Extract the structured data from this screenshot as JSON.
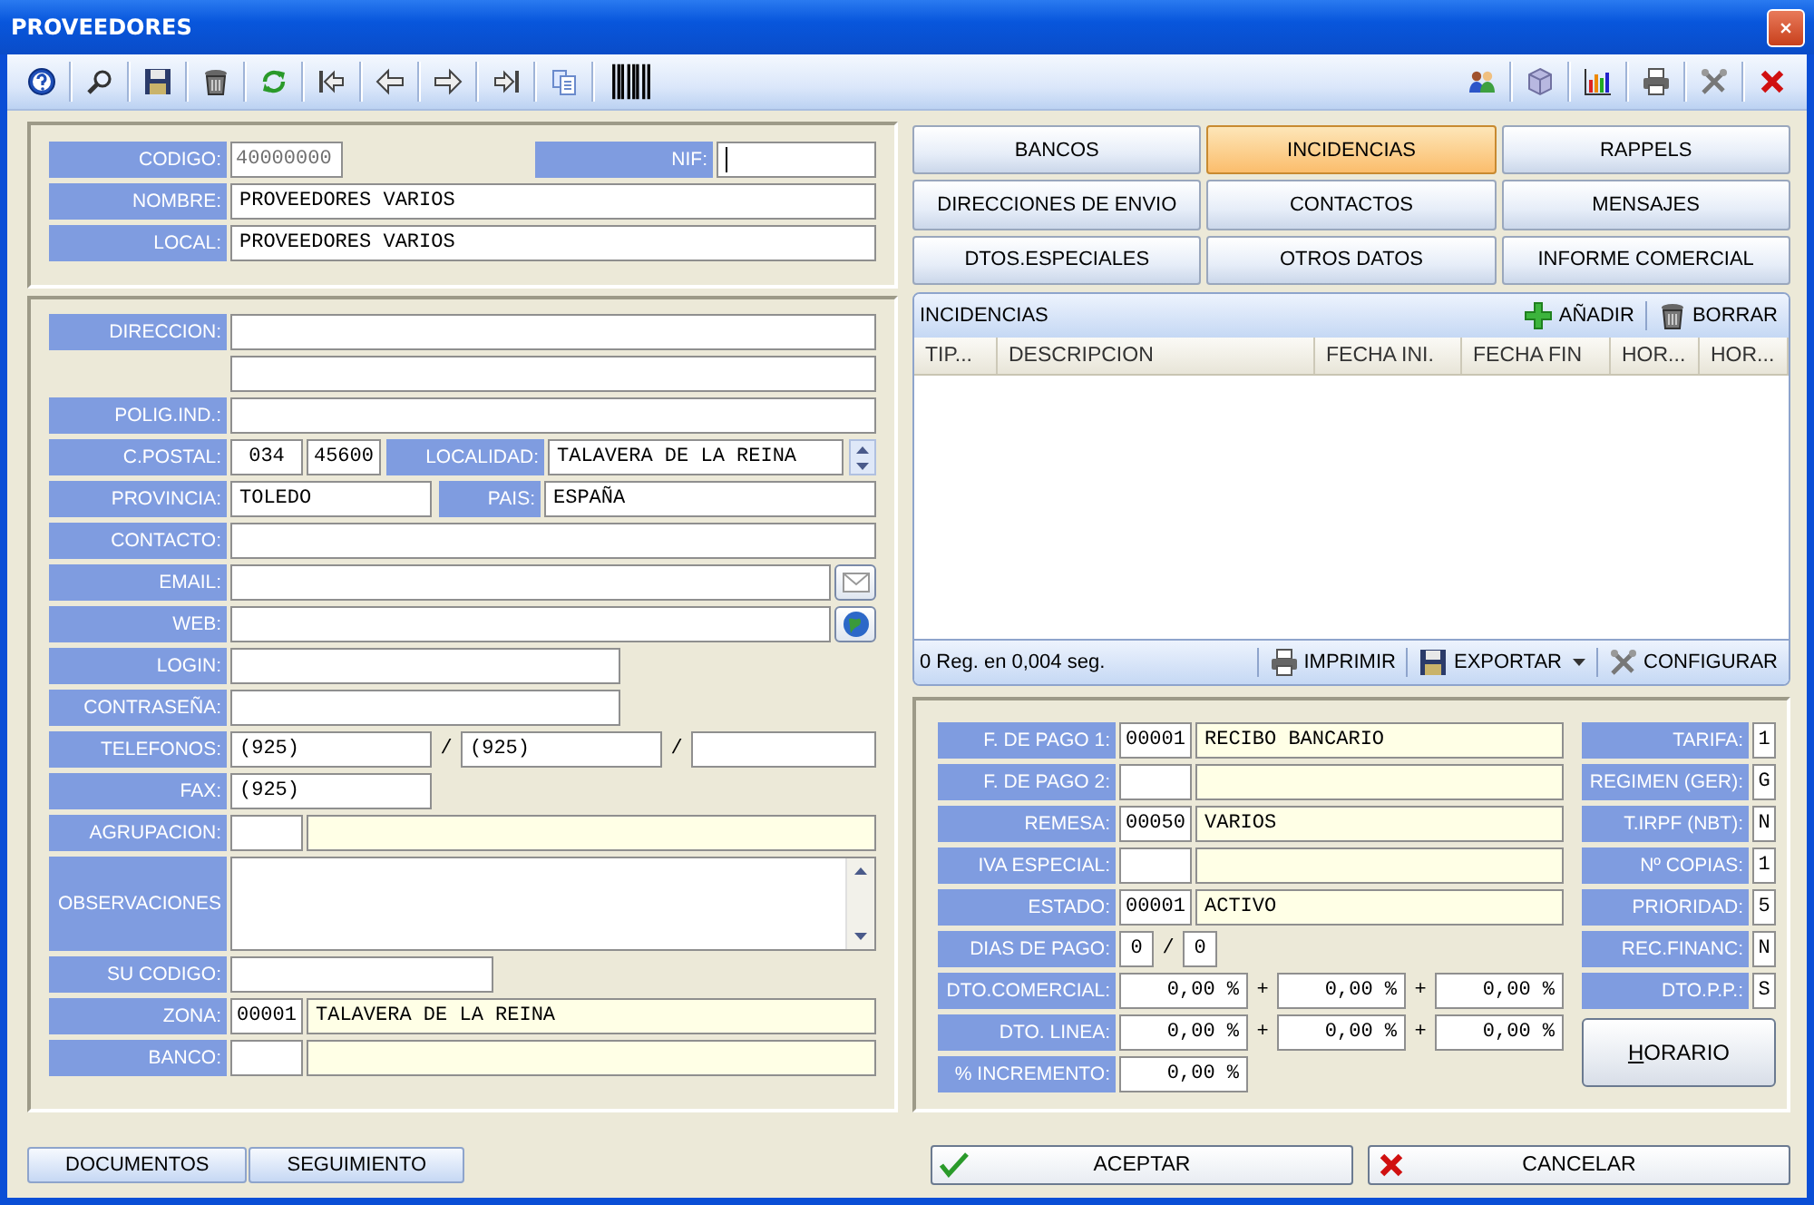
{
  "window": {
    "title": "PROVEEDORES"
  },
  "header_form": {
    "rows": [
      [
        {
          "kind": "label",
          "text": "CODIGO:"
        },
        {
          "kind": "code8",
          "value": "40000000",
          "disabled": true,
          "focused": false
        },
        {
          "kind": "spacer"
        },
        {
          "kind": "label",
          "text": "NIF:"
        },
        {
          "kind": "nif",
          "disabled": false,
          "focused": true
        }
      ],
      [
        {
          "kind": "label",
          "text": "NOMBRE:"
        },
        {
          "kind": "input",
          "value": "PROVEEDORES VARIOS"
        }
      ],
      [
        {
          "kind": "label",
          "text": "LOCAL:"
        },
        {
          "kind": "input",
          "value": "PROVEEDORES VARIOS"
        }
      ]
    ]
  },
  "address_form": {
    "rows": [
      [
        {
          "kind": "label",
          "text": "DIRECCION:"
        },
        {
          "kind": "input"
        }
      ],
      [
        {
          "kind": "gap"
        },
        {
          "kind": "input"
        }
      ],
      [
        {
          "kind": "label",
          "text": "POLIG.IND.:"
        },
        {
          "kind": "input"
        }
      ],
      [
        {
          "kind": "label",
          "text": "C.POSTAL:"
        },
        {
          "kind": "code",
          "value": "034"
        },
        {
          "kind": "zip",
          "value": "45600"
        },
        {
          "kind": "label-m",
          "text": "LOCALIDAD:"
        },
        {
          "kind": "input",
          "value": "TALAVERA DE LA REINA"
        },
        {
          "kind": "spin"
        }
      ],
      [
        {
          "kind": "label",
          "text": "PROVINCIA:"
        },
        {
          "kind": "md",
          "value": "TOLEDO"
        },
        {
          "kind": "label-s",
          "text": "PAIS:"
        },
        {
          "kind": "input",
          "value": "ESPAÑA"
        }
      ],
      [
        {
          "kind": "label",
          "text": "CONTACTO:"
        },
        {
          "kind": "input"
        }
      ],
      [
        {
          "kind": "label",
          "text": "EMAIL:"
        },
        {
          "kind": "input"
        },
        {
          "kind": "mail"
        }
      ],
      [
        {
          "kind": "label",
          "text": "WEB:"
        },
        {
          "kind": "input"
        },
        {
          "kind": "globe"
        }
      ],
      [
        {
          "kind": "label",
          "text": "LOGIN:"
        },
        {
          "kind": "lg"
        }
      ],
      [
        {
          "kind": "label",
          "text": "CONTRASEÑA:"
        },
        {
          "kind": "lg"
        }
      ],
      [
        {
          "kind": "label",
          "text": "TELEFONOS:"
        },
        {
          "kind": "md",
          "value": "(925)"
        },
        {
          "kind": "sep",
          "text": "/"
        },
        {
          "kind": "md",
          "value": "(925)"
        },
        {
          "kind": "sep",
          "text": "/"
        },
        {
          "kind": "input"
        }
      ],
      [
        {
          "kind": "label",
          "text": "FAX:"
        },
        {
          "kind": "md",
          "value": "(925)"
        }
      ],
      [
        {
          "kind": "label",
          "text": "AGRUPACION:"
        },
        {
          "kind": "code"
        },
        {
          "kind": "lookup"
        }
      ],
      [
        {
          "kind": "label",
          "text": "OBSERVACIONES"
        },
        {
          "kind": "memo"
        }
      ],
      [
        {
          "kind": "label",
          "text": "SU CODIGO:"
        },
        {
          "kind": "xl"
        }
      ],
      [
        {
          "kind": "label",
          "text": "ZONA:"
        },
        {
          "kind": "code",
          "value": "00001"
        },
        {
          "kind": "lookup",
          "value": "TALAVERA DE LA REINA"
        }
      ],
      [
        {
          "kind": "label",
          "text": "BANCO:"
        },
        {
          "kind": "code"
        },
        {
          "kind": "lookup"
        }
      ]
    ]
  },
  "tabs": [
    {
      "label": "BANCOS",
      "selected": false
    },
    {
      "label": "INCIDENCIAS",
      "selected": true
    },
    {
      "label": "RAPPELS",
      "selected": false
    },
    {
      "label": "DIRECCIONES DE ENVIO",
      "selected": false
    },
    {
      "label": "CONTACTOS",
      "selected": false
    },
    {
      "label": "MENSAJES",
      "selected": false
    },
    {
      "label": "DTOS.ESPECIALES",
      "selected": false
    },
    {
      "label": "OTROS DATOS",
      "selected": false
    },
    {
      "label": "INFORME COMERCIAL",
      "selected": false
    }
  ],
  "incidencias": {
    "title": "INCIDENCIAS",
    "actions": [
      "AÑADIR",
      "BORRAR"
    ],
    "columns": [
      "TIP...",
      "DESCRIPCION",
      "FECHA INI.",
      "FECHA FIN",
      "HOR...",
      "HOR..."
    ],
    "status": "0 Reg. en 0,004 seg.",
    "footer_actions": [
      {
        "label": "IMPRIMIR",
        "dropdown": false
      },
      {
        "label": "EXPORTAR",
        "dropdown": true
      },
      {
        "label": "CONFIGURAR",
        "dropdown": false
      }
    ]
  },
  "payment_form": {
    "rows": [
      [
        {
          "kind": "label",
          "text": "F. DE PAGO 1:"
        },
        {
          "kind": "code",
          "value": "00001"
        },
        {
          "kind": "lookup",
          "value": "RECIBO BANCARIO"
        }
      ],
      [
        {
          "kind": "label",
          "text": "F. DE PAGO 2:"
        },
        {
          "kind": "code"
        },
        {
          "kind": "lookup"
        }
      ],
      [
        {
          "kind": "label",
          "text": "REMESA:"
        },
        {
          "kind": "code",
          "value": "00050"
        },
        {
          "kind": "lookup",
          "value": "VARIOS"
        }
      ],
      [
        {
          "kind": "label",
          "text": "IVA ESPECIAL:"
        },
        {
          "kind": "code"
        },
        {
          "kind": "lookup"
        }
      ],
      [
        {
          "kind": "label",
          "text": "ESTADO:"
        },
        {
          "kind": "code",
          "value": "00001"
        },
        {
          "kind": "lookup",
          "value": "ACTIVO"
        }
      ],
      [
        {
          "kind": "label",
          "text": "DIAS DE PAGO:"
        },
        {
          "kind": "tiny",
          "value": "0"
        },
        {
          "kind": "sep",
          "text": "/"
        },
        {
          "kind": "tiny",
          "value": "0"
        }
      ],
      [
        {
          "kind": "label",
          "text": "DTO.COMERCIAL:"
        },
        {
          "kind": "num",
          "value": "0,00 %"
        },
        {
          "kind": "plus",
          "text": "+"
        },
        {
          "kind": "num",
          "value": "0,00 %"
        },
        {
          "kind": "plus",
          "text": "+"
        },
        {
          "kind": "num",
          "value": "0,00 %"
        }
      ],
      [
        {
          "kind": "label",
          "text": "DTO. LINEA:"
        },
        {
          "kind": "num",
          "value": "0,00 %"
        },
        {
          "kind": "plus",
          "text": "+"
        },
        {
          "kind": "num",
          "value": "0,00 %"
        },
        {
          "kind": "plus",
          "text": "+"
        },
        {
          "kind": "num",
          "value": "0,00 %"
        }
      ],
      [
        {
          "kind": "label",
          "text": "% INCREMENTO:"
        },
        {
          "kind": "num",
          "value": "0,00 %"
        }
      ]
    ],
    "flags": [
      {
        "label": "TARIFA:",
        "value": "1"
      },
      {
        "label": "REGIMEN (GER):",
        "value": "G"
      },
      {
        "label": "T.IRPF (NBT):",
        "value": "N"
      },
      {
        "label": "Nº COPIAS:",
        "value": "1"
      },
      {
        "label": "PRIORIDAD:",
        "value": "5"
      },
      {
        "label": "REC.FINANC:",
        "value": "N"
      },
      {
        "label": "DTO.P.P.:",
        "value": "S"
      }
    ],
    "button": "HORARIO"
  },
  "bottom_tabs": [
    "DOCUMENTOS",
    "SEGUIMIENTO"
  ],
  "buttons": [
    "ACEPTAR",
    "CANCELAR"
  ]
}
